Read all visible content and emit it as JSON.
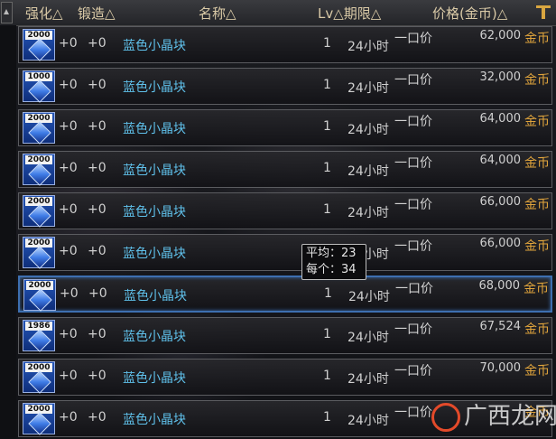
{
  "header": {
    "strengthen": "强化△",
    "forge": "锻造△",
    "name": "名称△",
    "lv_expire": "Lv△期限△",
    "price": "价格(金币)△"
  },
  "rows": [
    {
      "count": "2000",
      "strengthen": "+0",
      "forge": "+0",
      "name": "蓝色小晶块",
      "lv": "1",
      "expire": "24小时",
      "buy_type": "一口价",
      "price": "62,000",
      "currency": "金币"
    },
    {
      "count": "1000",
      "strengthen": "+0",
      "forge": "+0",
      "name": "蓝色小晶块",
      "lv": "1",
      "expire": "24小时",
      "buy_type": "一口价",
      "price": "32,000",
      "currency": "金币"
    },
    {
      "count": "2000",
      "strengthen": "+0",
      "forge": "+0",
      "name": "蓝色小晶块",
      "lv": "1",
      "expire": "24小时",
      "buy_type": "一口价",
      "price": "64,000",
      "currency": "金币"
    },
    {
      "count": "2000",
      "strengthen": "+0",
      "forge": "+0",
      "name": "蓝色小晶块",
      "lv": "1",
      "expire": "24小时",
      "buy_type": "一口价",
      "price": "64,000",
      "currency": "金币"
    },
    {
      "count": "2000",
      "strengthen": "+0",
      "forge": "+0",
      "name": "蓝色小晶块",
      "lv": "1",
      "expire": "24小时",
      "buy_type": "一口价",
      "price": "66,000",
      "currency": "金币"
    },
    {
      "count": "2000",
      "strengthen": "+0",
      "forge": "+0",
      "name": "蓝色小晶块",
      "lv": "1",
      "expire": "24小时",
      "buy_type": "一口价",
      "price": "66,000",
      "currency": "金币"
    },
    {
      "count": "2000",
      "strengthen": "+0",
      "forge": "+0",
      "name": "蓝色小晶块",
      "lv": "1",
      "expire": "24小时",
      "buy_type": "一口价",
      "price": "68,000",
      "currency": "金币"
    },
    {
      "count": "1986",
      "strengthen": "+0",
      "forge": "+0",
      "name": "蓝色小晶块",
      "lv": "1",
      "expire": "24小时",
      "buy_type": "一口价",
      "price": "67,524",
      "currency": "金币"
    },
    {
      "count": "2000",
      "strengthen": "+0",
      "forge": "+0",
      "name": "蓝色小晶块",
      "lv": "1",
      "expire": "24小时",
      "buy_type": "一口价",
      "price": "70,000",
      "currency": "金币"
    },
    {
      "count": "2000",
      "strengthen": "+0",
      "forge": "+0",
      "name": "蓝色小晶块",
      "lv": "1",
      "expire": "24小时",
      "buy_type": "一口价",
      "price": "",
      "currency": "金币"
    }
  ],
  "selected_row": 6,
  "tooltip": {
    "avg_line": "平均：23",
    "each_line": "每个：34"
  },
  "watermark": "广西龙网",
  "colors": {
    "item_name": "#5fc0ea",
    "gold_label": "#e0a43c",
    "selection_border": "#3d6fb0"
  }
}
